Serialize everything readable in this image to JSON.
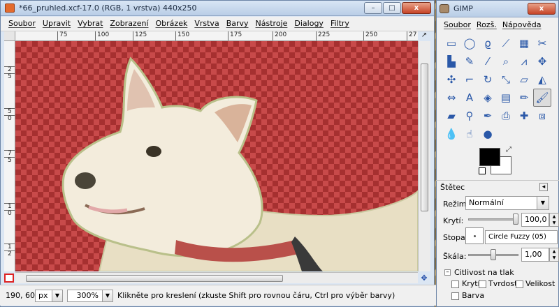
{
  "image_window": {
    "title": "*66_pruhled.xcf-17.0 (RGB, 1 vrstva) 440x250",
    "controls": {
      "minimize": "–",
      "maximize": "□",
      "close": "x"
    },
    "menu": [
      "Soubor",
      "Upravit",
      "Vybrat",
      "Zobrazení",
      "Obrázek",
      "Vrstva",
      "Barvy",
      "Nástroje",
      "Dialogy",
      "Filtry"
    ],
    "ruler_h": [
      "75",
      "100",
      "125",
      "150",
      "175",
      "200",
      "225",
      "250",
      "27"
    ],
    "ruler_v": [
      "2",
      "5",
      "5",
      "0",
      "7",
      "5",
      "1",
      "0",
      "1",
      "2"
    ],
    "nav_icon": "navigation-arrow-icon",
    "status": {
      "coords": "190, 60",
      "unit": "px",
      "zoom": "300%",
      "message": "Klikněte pro kreslení (zkuste Shift pro rovnou čáru, Ctrl pro výběr barvy)"
    }
  },
  "toolbox": {
    "title": "GIMP",
    "close": "x",
    "menu": [
      "Soubor",
      "Rozš.",
      "Nápověda"
    ],
    "tools": [
      {
        "icon": "rect-select-icon",
        "glyph": "▭"
      },
      {
        "icon": "ellipse-select-icon",
        "glyph": "◯"
      },
      {
        "icon": "lasso-icon",
        "glyph": "ϱ"
      },
      {
        "icon": "fuzzy-select-icon",
        "glyph": "⟋"
      },
      {
        "icon": "select-by-color-icon",
        "glyph": "▦"
      },
      {
        "icon": "scissors-icon",
        "glyph": "✂"
      },
      {
        "icon": "foreground-select-icon",
        "glyph": "▙"
      },
      {
        "icon": "paths-icon",
        "glyph": "✎"
      },
      {
        "icon": "color-picker-icon",
        "glyph": "⁄"
      },
      {
        "icon": "zoom-icon",
        "glyph": "⌕"
      },
      {
        "icon": "measure-icon",
        "glyph": "⩘"
      },
      {
        "icon": "move-icon",
        "glyph": "✥"
      },
      {
        "icon": "align-icon",
        "glyph": "✣"
      },
      {
        "icon": "crop-icon",
        "glyph": "⌐"
      },
      {
        "icon": "rotate-icon",
        "glyph": "↻"
      },
      {
        "icon": "scale-icon",
        "glyph": "⤡"
      },
      {
        "icon": "shear-icon",
        "glyph": "▱"
      },
      {
        "icon": "perspective-icon",
        "glyph": "◭"
      },
      {
        "icon": "flip-icon",
        "glyph": "⇔"
      },
      {
        "icon": "text-icon",
        "glyph": "A"
      },
      {
        "icon": "bucket-fill-icon",
        "glyph": "◈"
      },
      {
        "icon": "blend-icon",
        "glyph": "▤"
      },
      {
        "icon": "pencil-icon",
        "glyph": "✏"
      },
      {
        "icon": "paintbrush-icon",
        "glyph": "🖌"
      },
      {
        "icon": "eraser-icon",
        "glyph": "▰"
      },
      {
        "icon": "airbrush-icon",
        "glyph": "⚲"
      },
      {
        "icon": "ink-icon",
        "glyph": "✒"
      },
      {
        "icon": "clone-icon",
        "glyph": "⎙"
      },
      {
        "icon": "heal-icon",
        "glyph": "✚"
      },
      {
        "icon": "perspective-clone-icon",
        "glyph": "⧈"
      },
      {
        "icon": "blur-icon",
        "glyph": "💧"
      },
      {
        "icon": "smudge-icon",
        "glyph": "☝"
      },
      {
        "icon": "dodge-burn-icon",
        "glyph": "●"
      }
    ],
    "active_tool": "paintbrush-icon",
    "colors": {
      "foreground": "#000000",
      "background": "#ffffff"
    },
    "options": {
      "header": "Štětec",
      "mode_label": "Režim:",
      "mode_value": "Normální",
      "opacity_label": "Krytí:",
      "opacity_value": "100,0",
      "opacity_level": 1.0,
      "brush_label": "Stopa:",
      "brush_value": "Circle Fuzzy (05)",
      "scale_label": "Škála:",
      "scale_value": "1,00",
      "scale_level": 0.5,
      "pressure_label": "Citlivost na tlak",
      "checks": [
        "Krytí",
        "Tvrdost",
        "Velikost",
        "Barva"
      ]
    }
  },
  "accent": {
    "canvas_red": "#c84a4a",
    "checker_red": "#a63030",
    "title_blue": "#b9cde6"
  }
}
